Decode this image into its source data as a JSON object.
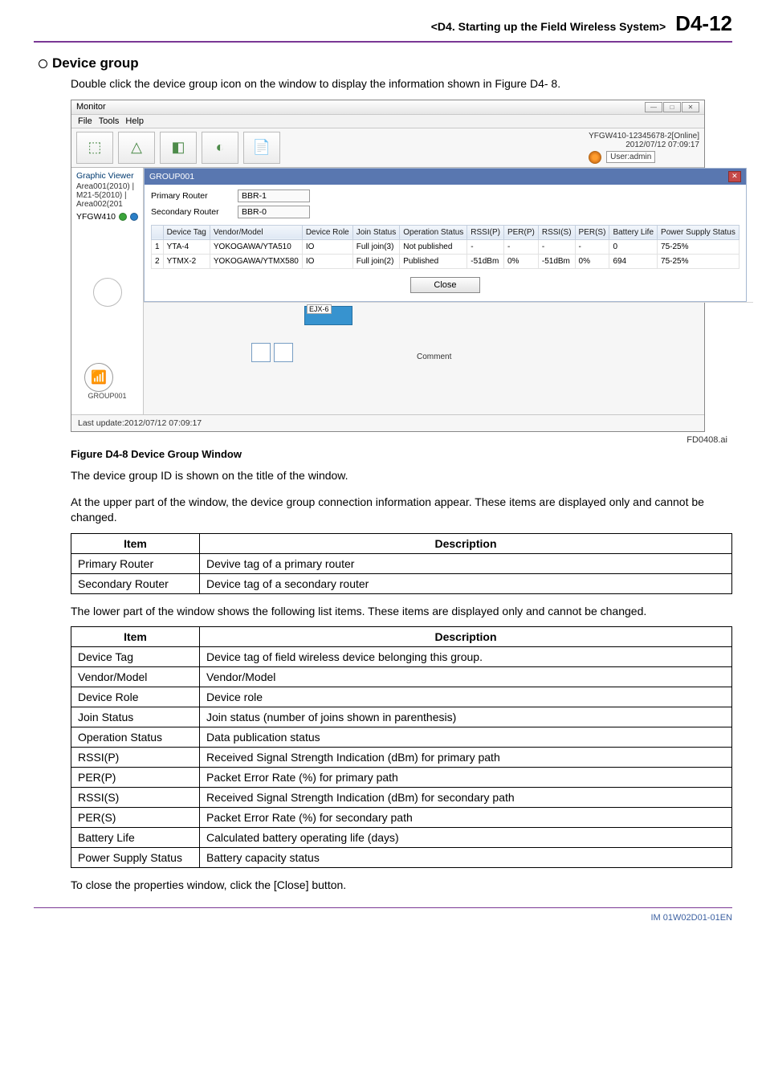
{
  "header": {
    "left": "<D4. Starting up the Field Wireless System>",
    "right": "D4-12"
  },
  "section": {
    "title": "Device group"
  },
  "intro": "Double click the device group icon on the window to display the information shown in Figure D4- 8.",
  "screenshot": {
    "title": "Monitor",
    "menubar": [
      "File",
      "Tools",
      "Help"
    ],
    "status": {
      "line1": "YFGW410-12345678-2[Online]",
      "line2": "2012/07/12 07:09:17",
      "user": "User:admin"
    },
    "side": {
      "graphic_viewer": "Graphic Viewer",
      "areas": "Area001(2010) | M21-5(2010) | Area002(201",
      "device": "YFGW410"
    },
    "group_panel": {
      "title": "GROUP001",
      "primary_label": "Primary Router",
      "primary_val": "BBR-1",
      "secondary_label": "Secondary Router",
      "secondary_val": "BBR-0",
      "cols": [
        "",
        "Device Tag",
        "Vendor/Model",
        "Device Role",
        "Join Status",
        "Operation Status",
        "RSSI(P)",
        "PER(P)",
        "RSSI(S)",
        "PER(S)",
        "Battery Life",
        "Power Supply Status"
      ],
      "rows": [
        [
          "1",
          "YTA-4",
          "YOKOGAWA/YTA510",
          "IO",
          "Full join(3)",
          "Not published",
          "-",
          "-",
          "-",
          "-",
          "0",
          "75-25%"
        ],
        [
          "2",
          "YTMX-2",
          "YOKOGAWA/YTMX580",
          "IO",
          "Full join(2)",
          "Published",
          "-51dBm",
          "0%",
          "-51dBm",
          "0%",
          "694",
          "75-25%"
        ]
      ],
      "close": "Close"
    },
    "canvas": {
      "group_label": "GROUP001",
      "chip_label": "EJX-6",
      "comment": "Comment"
    },
    "last_update": "Last update:2012/07/12 07:09:17"
  },
  "fig_id_right": "FD0408.ai",
  "fig_caption": "Figure D4-8  Device Group Window",
  "after_caption": "The device group ID is shown on the title of the window.",
  "connection_intro": "At the upper part of the window, the device group connection information appear. These items are displayed only and cannot be changed.",
  "table1": {
    "cols": [
      "Item",
      "Description"
    ],
    "rows": [
      [
        "Primary Router",
        "Devive tag of a primary router"
      ],
      [
        "Secondary Router",
        "Device tag of a secondary router"
      ]
    ]
  },
  "lower_intro": "The lower part of the window shows the following list items. These items are displayed only and cannot be changed.",
  "table2": {
    "cols": [
      "Item",
      "Description"
    ],
    "rows": [
      [
        "Device Tag",
        "Device tag of field wireless device belonging this group."
      ],
      [
        "Vendor/Model",
        "Vendor/Model"
      ],
      [
        "Device Role",
        "Device role"
      ],
      [
        "Join Status",
        "Join status (number of joins shown in parenthesis)"
      ],
      [
        "Operation Status",
        "Data publication status"
      ],
      [
        "RSSI(P)",
        "Received Signal Strength Indication (dBm) for primary path"
      ],
      [
        "PER(P)",
        "Packet Error Rate (%) for primary path"
      ],
      [
        "RSSI(S)",
        "Received Signal Strength Indication (dBm) for secondary path"
      ],
      [
        "PER(S)",
        "Packet Error Rate (%) for secondary path"
      ],
      [
        "Battery Life",
        "Calculated battery operating life (days)"
      ],
      [
        "Power Supply Status",
        "Battery capacity status"
      ]
    ]
  },
  "closing": "To close the properties window, click the [Close] button.",
  "footer": "IM 01W02D01-01EN"
}
